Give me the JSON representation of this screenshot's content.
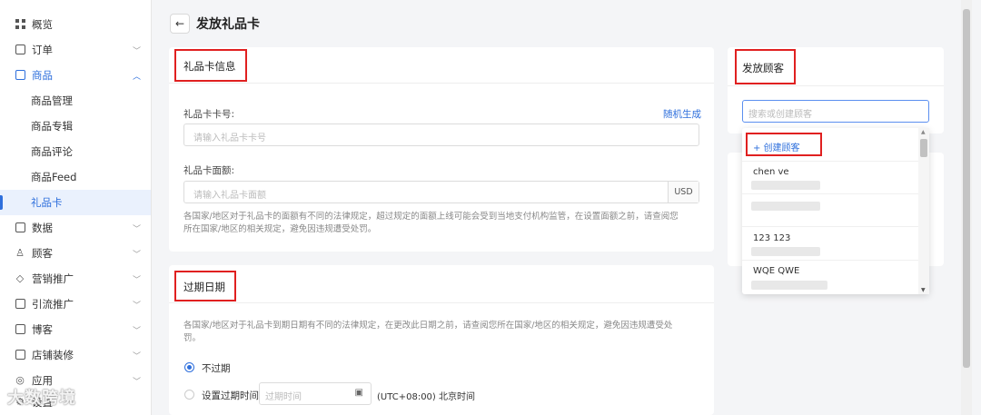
{
  "sidebar": {
    "items": [
      {
        "label": "概览",
        "icon": "grid-icon"
      },
      {
        "label": "订单",
        "icon": "order-icon"
      },
      {
        "label": "商品",
        "icon": "product-icon"
      },
      {
        "label": "商品管理"
      },
      {
        "label": "商品专辑"
      },
      {
        "label": "商品评论"
      },
      {
        "label": "商品Feed"
      },
      {
        "label": "礼品卡"
      },
      {
        "label": "数据",
        "icon": "chart-icon"
      },
      {
        "label": "顾客",
        "icon": "user-icon"
      },
      {
        "label": "营销推广",
        "icon": "tag-icon"
      },
      {
        "label": "引流推广",
        "icon": "doc-icon"
      },
      {
        "label": "博客",
        "icon": "blog-icon"
      },
      {
        "label": "店铺装修",
        "icon": "store-icon"
      },
      {
        "label": "应用",
        "icon": "app-icon"
      },
      {
        "label": "设置",
        "icon": "gear-icon"
      }
    ]
  },
  "header": {
    "back": "←",
    "title": "发放礼品卡"
  },
  "info_card": {
    "title": "礼品卡信息",
    "code_label": "礼品卡卡号:",
    "random_link": "随机生成",
    "code_placeholder": "请输入礼品卡卡号",
    "amount_label": "礼品卡面额:",
    "amount_placeholder": "请输入礼品卡面额",
    "currency": "USD",
    "help_line1": "各国家/地区对于礼品卡的面额有不同的法律规定，超过规定的面额上线可能会受到当地支付机构监管，在设置面额之前，请查阅您",
    "help_line2": "所在国家/地区的相关规定，避免因违规遭受处罚。"
  },
  "expiry_card": {
    "title": "过期日期",
    "help_line1": "各国家/地区对于礼品卡到期日期有不同的法律规定，在更改此日期之前，请查阅您所在国家/地区的相关规定，避免因违规遭受处",
    "help_line2": "罚。",
    "option_never": "不过期",
    "option_set": "设置过期时间",
    "date_placeholder": "过期时间",
    "timezone": "(UTC+08:00) 北京时间"
  },
  "customer_card": {
    "title": "发放顾客",
    "search_placeholder": "搜索或创建顾客",
    "create": "+ 创建顾客",
    "customers": [
      {
        "name": "chen ve"
      },
      {
        "name": ""
      },
      {
        "name": "123 123"
      },
      {
        "name": "WQE QWE"
      }
    ]
  },
  "watermark": "大数跨境",
  "colors": {
    "accent": "#2e6fdc",
    "highlight": "#e02020"
  }
}
